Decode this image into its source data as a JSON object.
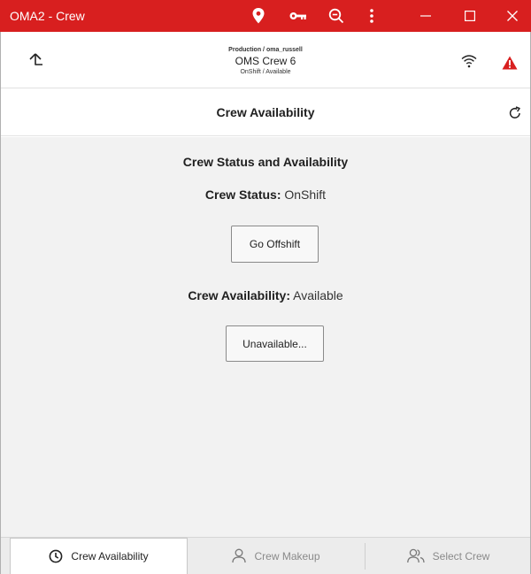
{
  "window": {
    "title": "OMA2 - Crew",
    "toolbar_icons": [
      "location-pin-icon",
      "key-icon",
      "zoom-out-icon",
      "more-vertical-icon"
    ],
    "controls": [
      "minimize-icon",
      "maximize-icon",
      "close-icon"
    ],
    "accent_color": "#d81f1f"
  },
  "context": {
    "environment": "Production / oma_russell",
    "crew_name": "OMS Crew 6",
    "crew_status_summary": "OnShift / Available",
    "icons": [
      "back-arrow-icon",
      "wifi-icon",
      "warning-icon"
    ],
    "warning_color": "#d81f1f"
  },
  "page": {
    "title": "Crew Availability",
    "refresh_icon": "refresh-icon"
  },
  "main": {
    "section_title": "Crew Status and Availability",
    "crew_status_label": "Crew Status:",
    "crew_status_value": "OnShift",
    "go_offshift_label": "Go Offshift",
    "crew_availability_label": "Crew Availability:",
    "crew_availability_value": "Available",
    "unavailable_label": "Unavailable..."
  },
  "tabs": [
    {
      "label": "Crew Availability",
      "icon": "clock-icon",
      "active": true
    },
    {
      "label": "Crew Makeup",
      "icon": "person-icon",
      "active": false
    },
    {
      "label": "Select Crew",
      "icon": "people-icon",
      "active": false
    }
  ]
}
